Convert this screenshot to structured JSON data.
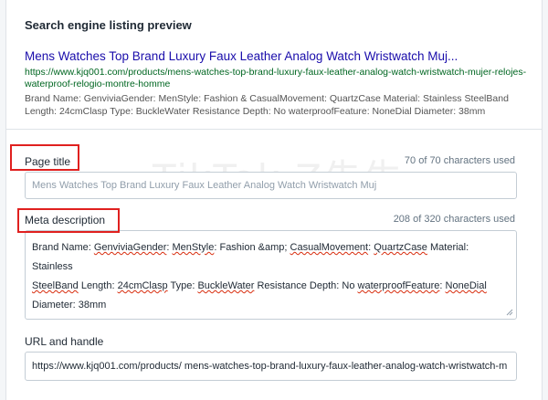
{
  "preview": {
    "heading": "Search engine listing preview",
    "title": "Mens Watches Top Brand Luxury Faux Leather Analog Watch Wristwatch Muj...",
    "url": "https://www.kjq001.com/products/mens-watches-top-brand-luxury-faux-leather-analog-watch-wristwatch-mujer-relojes-waterproof-relogio-montre-homme",
    "description": "Brand Name: GenviviaGender: MenStyle: Fashion & CasualMovement: QuartzCase Material: Stainless SteelBand Length: 24cmClasp Type: BuckleWater Resistance Depth: No waterproofFeature: NoneDial Diameter: 38mm"
  },
  "page_title": {
    "label": "Page title",
    "counter": "70 of 70 characters used",
    "value": "Mens Watches Top Brand Luxury Faux Leather Analog Watch Wristwatch Muj"
  },
  "meta_description": {
    "label": "Meta description",
    "counter": "208 of 320 characters used",
    "lines": {
      "l1_a": "Brand Name: ",
      "l1_b": "GenviviaGender",
      "l1_c": ": ",
      "l1_d": "MenStyle",
      "l1_e": ": Fashion &amp; ",
      "l1_f": "CasualMovement",
      "l1_g": ": ",
      "l1_h": "QuartzCase",
      "l1_i": " Material: Stainless",
      "l2_a": "SteelBand",
      "l2_b": " Length: ",
      "l2_c": "24cmClasp",
      "l2_d": " Type: ",
      "l2_e": "BuckleWater",
      "l2_f": " Resistance Depth: No ",
      "l2_g": "waterproofFeature",
      "l2_h": ": ",
      "l2_i": "NoneDial",
      "l3_a": "Diameter: 38mm"
    }
  },
  "url_handle": {
    "label": "URL and handle",
    "value": "https://www.kjq001.com/products/ mens-watches-top-brand-luxury-faux-leather-analog-watch-wristwatch-m"
  },
  "watermark": "TikTok Z先生",
  "colors": {
    "link_blue": "#1a0dab",
    "url_green": "#006621",
    "highlight_red": "#e0201f"
  }
}
